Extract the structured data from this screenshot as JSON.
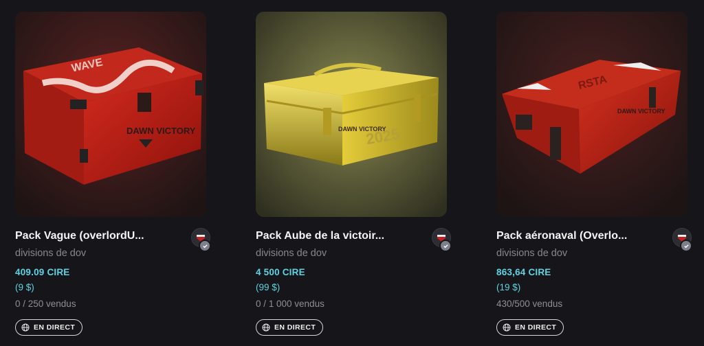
{
  "cards": [
    {
      "title": "Pack Vague (overlordU...",
      "creator": "divisions de dov",
      "price": "409.09 CIRE",
      "usd": "(9 $)",
      "sold": "0 / 250 vendus",
      "live_label": "EN DIRECT",
      "image_icon": "red-wave-crate-image",
      "crate_text": "WAVE",
      "brand_text": "DAWN VICTORY"
    },
    {
      "title": "Pack Aube de la victoir...",
      "creator": "divisions de dov",
      "price": "4 500 CIRE",
      "usd": "(99 $)",
      "sold": "0 / 1 000 vendus",
      "live_label": "EN DIRECT",
      "image_icon": "gold-crate-image",
      "crate_text": "2025",
      "brand_text": "DAWN VICTORY"
    },
    {
      "title": "Pack aéronaval (Overlo...",
      "creator": "divisions de dov",
      "price": "863,64 CIRE",
      "usd": "(19 $)",
      "sold": "430/500 vendus",
      "live_label": "EN DIRECT",
      "image_icon": "red-long-crate-image",
      "crate_text": "RSTA",
      "brand_text": "DAWN VICTORY"
    }
  ],
  "colors": {
    "background": "#16161a",
    "accent_price": "#5fd3e3",
    "muted_text": "#86888f"
  }
}
